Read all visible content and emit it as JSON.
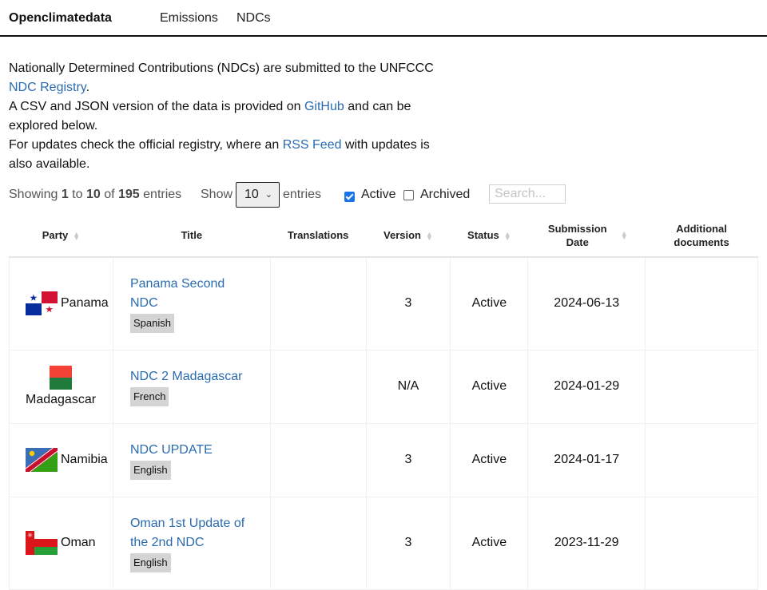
{
  "navbar": {
    "brand": "Openclimatedata",
    "links": [
      "Emissions",
      "NDCs"
    ]
  },
  "intro": {
    "line1_text": "Nationally Determined Contributions (NDCs) are submitted to the UNFCCC ",
    "line1_link": "NDC Registry",
    "line1_end": ".",
    "line2_text": "A CSV and JSON version of the data is provided on ",
    "line2_link": "GitHub",
    "line2_end": " and can be explored below.",
    "line3_text": "For updates check the official registry, where an ",
    "line3_link": "RSS Feed",
    "line3_end": " with updates is also available."
  },
  "controls": {
    "info_prefix": "Showing ",
    "info_start": "1",
    "info_to": " to ",
    "info_end": "10",
    "info_of": " of ",
    "info_total": "195",
    "info_suffix": " entries",
    "show_label": "Show",
    "page_length": "10",
    "entries_label": "entries",
    "filter_active_label": "Active",
    "filter_active_checked": true,
    "filter_archived_label": "Archived",
    "filter_archived_checked": false,
    "search_placeholder": "Search...",
    "search_value": ""
  },
  "table": {
    "columns": [
      {
        "label": "Party",
        "sortable": true
      },
      {
        "label": "Title",
        "sortable": false
      },
      {
        "label": "Translations",
        "sortable": false
      },
      {
        "label": "Version",
        "sortable": true
      },
      {
        "label": "Status",
        "sortable": true
      },
      {
        "label": "Submission Date",
        "sortable": true
      },
      {
        "label": "Additional documents",
        "sortable": false
      }
    ],
    "rows": [
      {
        "party": "Panama",
        "flag": "panama-flag",
        "title": "Panama Second NDC",
        "language": "Spanish",
        "translations": "",
        "version": "3",
        "status": "Active",
        "date": "2024-06-13",
        "additional": ""
      },
      {
        "party": "Madagascar",
        "flag": "madagascar-flag",
        "title": "NDC 2 Madagascar",
        "language": "French",
        "translations": "",
        "version": "N/A",
        "status": "Active",
        "date": "2024-01-29",
        "additional": ""
      },
      {
        "party": "Namibia",
        "flag": "namibia-flag",
        "title": "NDC UPDATE",
        "language": "English",
        "translations": "",
        "version": "3",
        "status": "Active",
        "date": "2024-01-17",
        "additional": ""
      },
      {
        "party": "Oman",
        "flag": "oman-flag",
        "title": "Oman 1st Update of the 2nd NDC",
        "language": "English",
        "translations": "",
        "version": "3",
        "status": "Active",
        "date": "2023-11-29",
        "additional": ""
      }
    ]
  },
  "colors": {
    "link": "#2a6bb0",
    "checkbox_checked": "#1a73e8",
    "badge_bg": "#d4d4d4"
  }
}
